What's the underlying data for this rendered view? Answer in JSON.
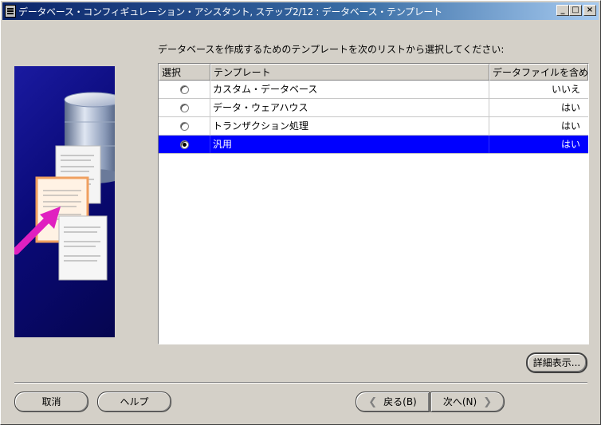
{
  "window": {
    "title": "データベース・コンフィギュレーション・アシスタント, ステップ2/12 : データベース・テンプレート",
    "minimize_glyph": "_",
    "maximize_glyph": "□",
    "close_glyph": "×"
  },
  "instruction": "データベースを作成するためのテンプレートを次のリストから選択してください:",
  "table": {
    "headers": [
      "選択",
      "テンプレート",
      "データファイルを含め"
    ],
    "rows": [
      {
        "template": "カスタム・データベース",
        "includes_datafiles": "いいえ",
        "selected": false
      },
      {
        "template": "データ・ウェアハウス",
        "includes_datafiles": "はい",
        "selected": false
      },
      {
        "template": "トランザクション処理",
        "includes_datafiles": "はい",
        "selected": false
      },
      {
        "template": "汎用",
        "includes_datafiles": "はい",
        "selected": true
      }
    ]
  },
  "buttons": {
    "details": "詳細表示...",
    "cancel": "取消",
    "help": "ヘルプ",
    "back": "戻る(B)",
    "next": "次へ(N)"
  },
  "colors": {
    "selection": "#0000ff",
    "titlebar_start": "#0a246a",
    "illustration_bg": "#0a0a78"
  },
  "icons": {
    "illustration": "database-documents-illustration",
    "back_arrow": "chevron-left-icon",
    "next_arrow": "chevron-right-icon"
  }
}
